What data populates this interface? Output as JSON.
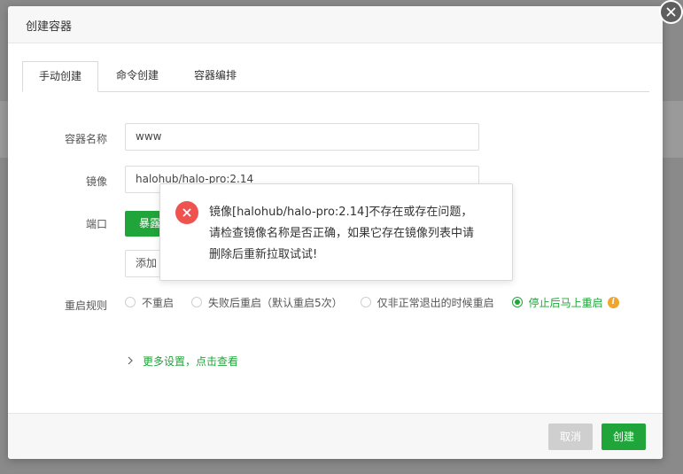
{
  "dialog": {
    "title": "创建容器"
  },
  "tabs": [
    {
      "label": "手动创建",
      "active": true
    },
    {
      "label": "命令创建",
      "active": false
    },
    {
      "label": "容器编排",
      "active": false
    }
  ],
  "form": {
    "name_label": "容器名称",
    "name_value": "www",
    "image_label": "镜像",
    "image_value": "halohub/halo-pro:2.14",
    "port_label": "端口",
    "expose_button": "暴露",
    "add_button": "添加",
    "restart_label": "重启规则",
    "restart_options": [
      {
        "label": "不重启",
        "checked": false
      },
      {
        "label": "失败后重启（默认重启5次）",
        "checked": false
      },
      {
        "label": "仅非正常退出的时候重启",
        "checked": false
      },
      {
        "label": "停止后马上重启",
        "checked": true
      }
    ],
    "more_settings": "更多设置，点击查看"
  },
  "footer": {
    "cancel": "取消",
    "create": "创建"
  },
  "error_toast": {
    "line1": "镜像[halohub/halo-pro:2.14]不存在或存在问题，",
    "line2": "请检查镜像名称是否正确，如果它存在镜像列表中请",
    "line3": "删除后重新拉取试试!"
  },
  "colors": {
    "accent": "#20a53a",
    "error": "#ef5350",
    "info": "#f0a52b"
  },
  "icons": [
    "close-icon",
    "chevron-down-icon",
    "info-icon",
    "chevron-right-icon",
    "error-icon"
  ]
}
